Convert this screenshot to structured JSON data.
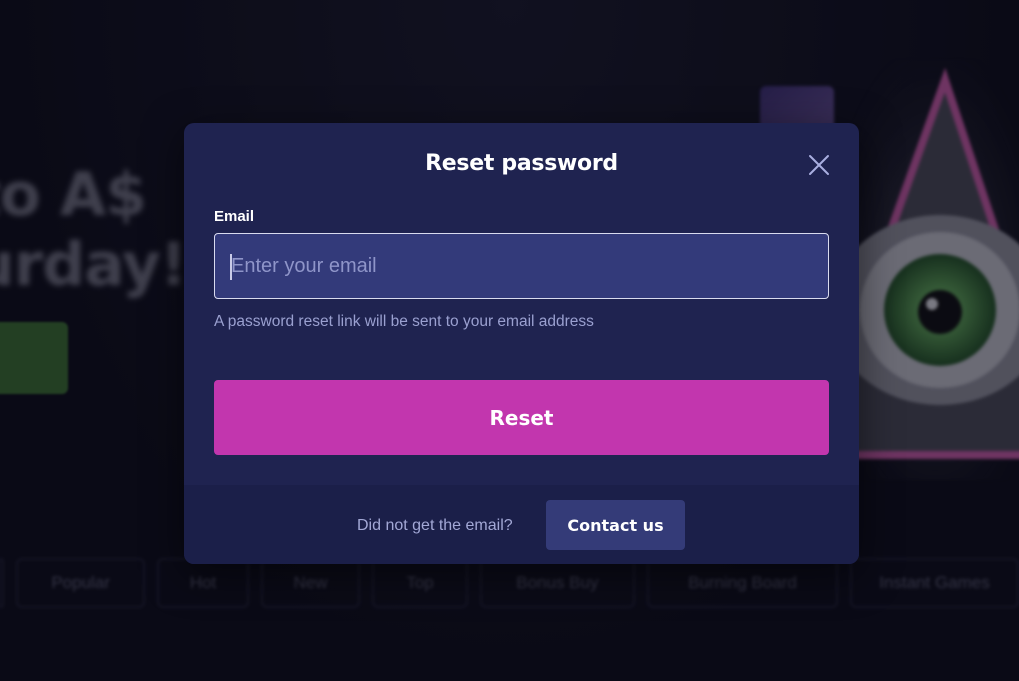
{
  "background": {
    "hero_line1": "to A$",
    "hero_line2": "urday!",
    "categories": [
      "Popular",
      "Hot",
      "New",
      "Top",
      "Bonus Buy",
      "Burning Board",
      "Instant Games"
    ]
  },
  "modal": {
    "title": "Reset password",
    "email_label": "Email",
    "email_placeholder": "Enter your email",
    "email_value": "",
    "hint": "A password reset link will be sent to your email address",
    "reset_label": "Reset",
    "footer_text": "Did not get the email?",
    "contact_label": "Contact us",
    "close_icon": "close-icon"
  },
  "colors": {
    "modal_bg": "#1f2350",
    "input_bg": "#333a7a",
    "accent": "#c236ae",
    "footer_bg": "#1b1f49",
    "contact_bg": "#343b78"
  }
}
